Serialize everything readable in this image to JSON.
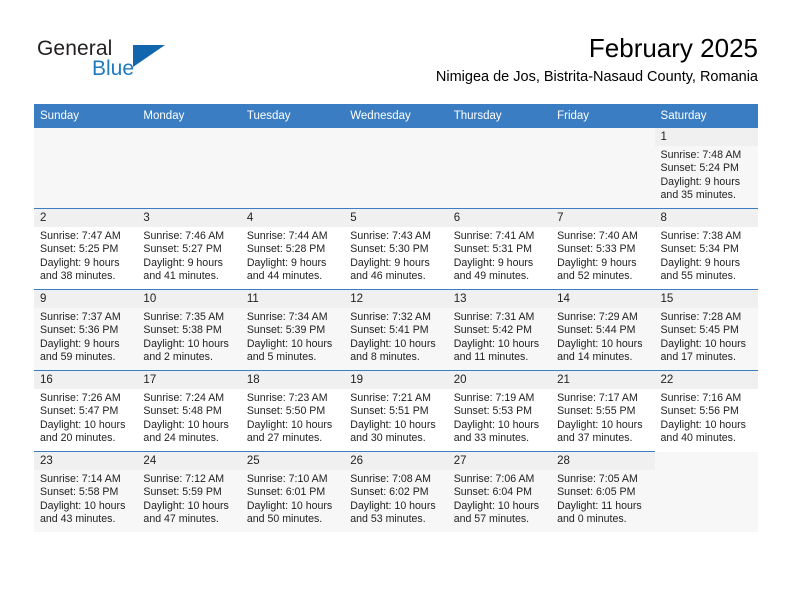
{
  "brand": {
    "name_top": "General",
    "name_bottom": "Blue",
    "triangle_color": "#1266ad",
    "blue_color": "#1f7bc1",
    "dark_color": "#231f20"
  },
  "header": {
    "month_title": "February 2025",
    "location": "Nimigea de Jos, Bistrita-Nasaud County, Romania"
  },
  "theme": {
    "header_bg": "#3a7dc2",
    "header_text": "#ffffff",
    "daynum_bg": "#f0f0f0",
    "cell_bg": "#ffffff"
  },
  "weekdays": [
    "Sunday",
    "Monday",
    "Tuesday",
    "Wednesday",
    "Thursday",
    "Friday",
    "Saturday"
  ],
  "labels": {
    "sunrise_prefix": "Sunrise:",
    "sunset_prefix": "Sunset:",
    "daylight_prefix": "Daylight:"
  },
  "weeks": [
    [
      {
        "empty": true
      },
      {
        "empty": true
      },
      {
        "empty": true
      },
      {
        "empty": true
      },
      {
        "empty": true
      },
      {
        "empty": true
      },
      {
        "day": "1",
        "sunrise": "Sunrise: 7:48 AM",
        "sunset": "Sunset: 5:24 PM",
        "daylight_1": "Daylight: 9 hours",
        "daylight_2": "and 35 minutes."
      }
    ],
    [
      {
        "day": "2",
        "sunrise": "Sunrise: 7:47 AM",
        "sunset": "Sunset: 5:25 PM",
        "daylight_1": "Daylight: 9 hours",
        "daylight_2": "and 38 minutes."
      },
      {
        "day": "3",
        "sunrise": "Sunrise: 7:46 AM",
        "sunset": "Sunset: 5:27 PM",
        "daylight_1": "Daylight: 9 hours",
        "daylight_2": "and 41 minutes."
      },
      {
        "day": "4",
        "sunrise": "Sunrise: 7:44 AM",
        "sunset": "Sunset: 5:28 PM",
        "daylight_1": "Daylight: 9 hours",
        "daylight_2": "and 44 minutes."
      },
      {
        "day": "5",
        "sunrise": "Sunrise: 7:43 AM",
        "sunset": "Sunset: 5:30 PM",
        "daylight_1": "Daylight: 9 hours",
        "daylight_2": "and 46 minutes."
      },
      {
        "day": "6",
        "sunrise": "Sunrise: 7:41 AM",
        "sunset": "Sunset: 5:31 PM",
        "daylight_1": "Daylight: 9 hours",
        "daylight_2": "and 49 minutes."
      },
      {
        "day": "7",
        "sunrise": "Sunrise: 7:40 AM",
        "sunset": "Sunset: 5:33 PM",
        "daylight_1": "Daylight: 9 hours",
        "daylight_2": "and 52 minutes."
      },
      {
        "day": "8",
        "sunrise": "Sunrise: 7:38 AM",
        "sunset": "Sunset: 5:34 PM",
        "daylight_1": "Daylight: 9 hours",
        "daylight_2": "and 55 minutes."
      }
    ],
    [
      {
        "day": "9",
        "sunrise": "Sunrise: 7:37 AM",
        "sunset": "Sunset: 5:36 PM",
        "daylight_1": "Daylight: 9 hours",
        "daylight_2": "and 59 minutes."
      },
      {
        "day": "10",
        "sunrise": "Sunrise: 7:35 AM",
        "sunset": "Sunset: 5:38 PM",
        "daylight_1": "Daylight: 10 hours",
        "daylight_2": "and 2 minutes."
      },
      {
        "day": "11",
        "sunrise": "Sunrise: 7:34 AM",
        "sunset": "Sunset: 5:39 PM",
        "daylight_1": "Daylight: 10 hours",
        "daylight_2": "and 5 minutes."
      },
      {
        "day": "12",
        "sunrise": "Sunrise: 7:32 AM",
        "sunset": "Sunset: 5:41 PM",
        "daylight_1": "Daylight: 10 hours",
        "daylight_2": "and 8 minutes."
      },
      {
        "day": "13",
        "sunrise": "Sunrise: 7:31 AM",
        "sunset": "Sunset: 5:42 PM",
        "daylight_1": "Daylight: 10 hours",
        "daylight_2": "and 11 minutes."
      },
      {
        "day": "14",
        "sunrise": "Sunrise: 7:29 AM",
        "sunset": "Sunset: 5:44 PM",
        "daylight_1": "Daylight: 10 hours",
        "daylight_2": "and 14 minutes."
      },
      {
        "day": "15",
        "sunrise": "Sunrise: 7:28 AM",
        "sunset": "Sunset: 5:45 PM",
        "daylight_1": "Daylight: 10 hours",
        "daylight_2": "and 17 minutes."
      }
    ],
    [
      {
        "day": "16",
        "sunrise": "Sunrise: 7:26 AM",
        "sunset": "Sunset: 5:47 PM",
        "daylight_1": "Daylight: 10 hours",
        "daylight_2": "and 20 minutes."
      },
      {
        "day": "17",
        "sunrise": "Sunrise: 7:24 AM",
        "sunset": "Sunset: 5:48 PM",
        "daylight_1": "Daylight: 10 hours",
        "daylight_2": "and 24 minutes."
      },
      {
        "day": "18",
        "sunrise": "Sunrise: 7:23 AM",
        "sunset": "Sunset: 5:50 PM",
        "daylight_1": "Daylight: 10 hours",
        "daylight_2": "and 27 minutes."
      },
      {
        "day": "19",
        "sunrise": "Sunrise: 7:21 AM",
        "sunset": "Sunset: 5:51 PM",
        "daylight_1": "Daylight: 10 hours",
        "daylight_2": "and 30 minutes."
      },
      {
        "day": "20",
        "sunrise": "Sunrise: 7:19 AM",
        "sunset": "Sunset: 5:53 PM",
        "daylight_1": "Daylight: 10 hours",
        "daylight_2": "and 33 minutes."
      },
      {
        "day": "21",
        "sunrise": "Sunrise: 7:17 AM",
        "sunset": "Sunset: 5:55 PM",
        "daylight_1": "Daylight: 10 hours",
        "daylight_2": "and 37 minutes."
      },
      {
        "day": "22",
        "sunrise": "Sunrise: 7:16 AM",
        "sunset": "Sunset: 5:56 PM",
        "daylight_1": "Daylight: 10 hours",
        "daylight_2": "and 40 minutes."
      }
    ],
    [
      {
        "day": "23",
        "sunrise": "Sunrise: 7:14 AM",
        "sunset": "Sunset: 5:58 PM",
        "daylight_1": "Daylight: 10 hours",
        "daylight_2": "and 43 minutes."
      },
      {
        "day": "24",
        "sunrise": "Sunrise: 7:12 AM",
        "sunset": "Sunset: 5:59 PM",
        "daylight_1": "Daylight: 10 hours",
        "daylight_2": "and 47 minutes."
      },
      {
        "day": "25",
        "sunrise": "Sunrise: 7:10 AM",
        "sunset": "Sunset: 6:01 PM",
        "daylight_1": "Daylight: 10 hours",
        "daylight_2": "and 50 minutes."
      },
      {
        "day": "26",
        "sunrise": "Sunrise: 7:08 AM",
        "sunset": "Sunset: 6:02 PM",
        "daylight_1": "Daylight: 10 hours",
        "daylight_2": "and 53 minutes."
      },
      {
        "day": "27",
        "sunrise": "Sunrise: 7:06 AM",
        "sunset": "Sunset: 6:04 PM",
        "daylight_1": "Daylight: 10 hours",
        "daylight_2": "and 57 minutes."
      },
      {
        "day": "28",
        "sunrise": "Sunrise: 7:05 AM",
        "sunset": "Sunset: 6:05 PM",
        "daylight_1": "Daylight: 11 hours",
        "daylight_2": "and 0 minutes."
      },
      {
        "empty": true
      }
    ]
  ]
}
